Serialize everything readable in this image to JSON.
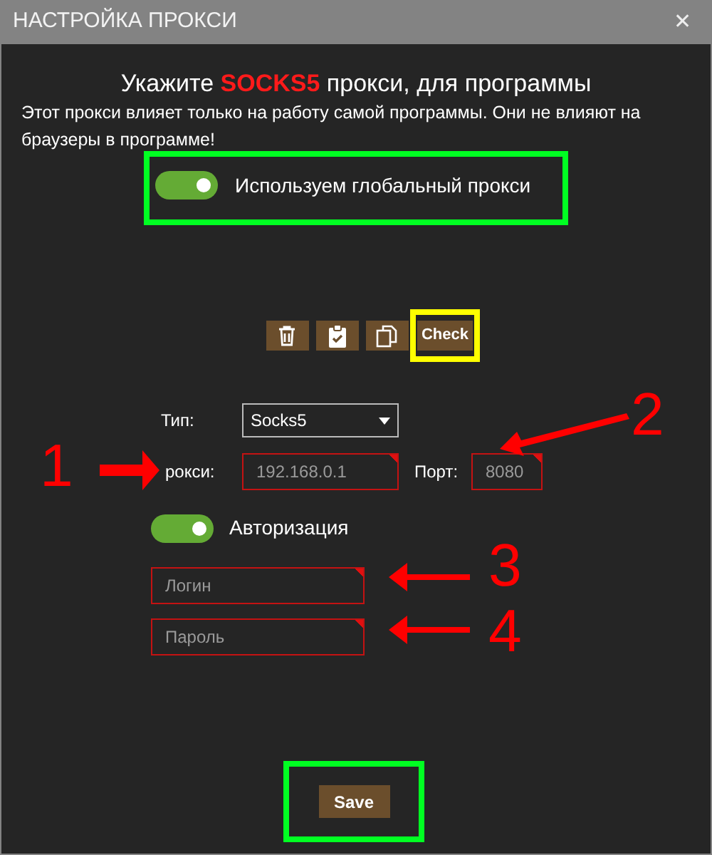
{
  "window": {
    "title": "НАСТРОЙКА ПРОКСИ",
    "close": "✕"
  },
  "heading": "Укажите **SOCKS5** прокси, для программы",
  "description": "Этот прокси влияет только на работу самой программы. Они не влияют на браузеры в программе!",
  "global_proxy": {
    "label": "Используем глобальный прокси",
    "on": true
  },
  "toolbar": [
    {
      "kind": "trash"
    },
    {
      "kind": "clipboard"
    },
    {
      "kind": "copy"
    },
    {
      "kind": "text",
      "label": "Check"
    }
  ],
  "type": {
    "label": "Тип:",
    "value": "Socks5"
  },
  "proxy": {
    "label": "рокси:",
    "value": "192.168.0.1",
    "invalid": true
  },
  "port": {
    "label": "Порт:",
    "value": "8080",
    "invalid": true
  },
  "auth": {
    "label": "Авторизация",
    "on": true
  },
  "login": {
    "placeholder": "Логин",
    "invalid": true
  },
  "password": {
    "placeholder": "Пароль",
    "invalid": true
  },
  "save": "Save",
  "annotations": [
    {
      "label": "1"
    },
    {
      "label": "2"
    },
    {
      "label": "3"
    },
    {
      "label": "4"
    }
  ]
}
